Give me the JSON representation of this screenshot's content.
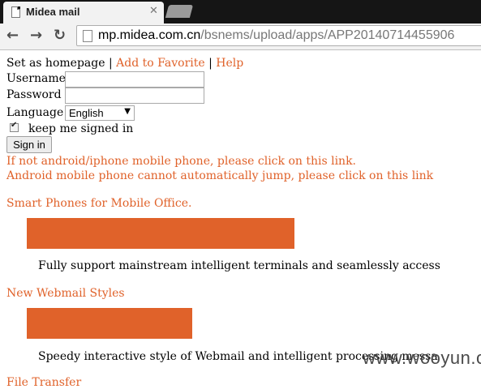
{
  "browser": {
    "tab_title": "Midea mail",
    "url_host": "mp.midea.com.cn",
    "url_path": "/bsnems/upload/apps/APP20140714455906"
  },
  "header_links": {
    "set_homepage": "Set as homepage",
    "separator": "|",
    "add_favorite": "Add to Favorite",
    "help": "Help"
  },
  "form": {
    "username_label": "Username",
    "username_value": "",
    "password_label": "Password",
    "password_value": "",
    "language_label": "Language",
    "language_selected": "English",
    "keep_signed_in_label": "keep me signed in",
    "keep_signed_in_checked": true,
    "sign_in_label": "Sign in"
  },
  "notices": {
    "line1": "If not android/iphone mobile phone, please click on this link.",
    "line2": "Android mobile phone cannot automatically jump, please click on this link"
  },
  "sections": [
    {
      "title": "Smart Phones for Mobile Office.",
      "description": "Fully support mainstream intelligent terminals and seamlessly access"
    },
    {
      "title": "New Webmail Styles",
      "description": "Speedy interactive style of Webmail and intelligent processing messa"
    },
    {
      "title": "File Transfer"
    }
  ],
  "watermark": "www.wooyun.org",
  "colors": {
    "accent": "#e0622a",
    "tab_strip": "#151515"
  }
}
